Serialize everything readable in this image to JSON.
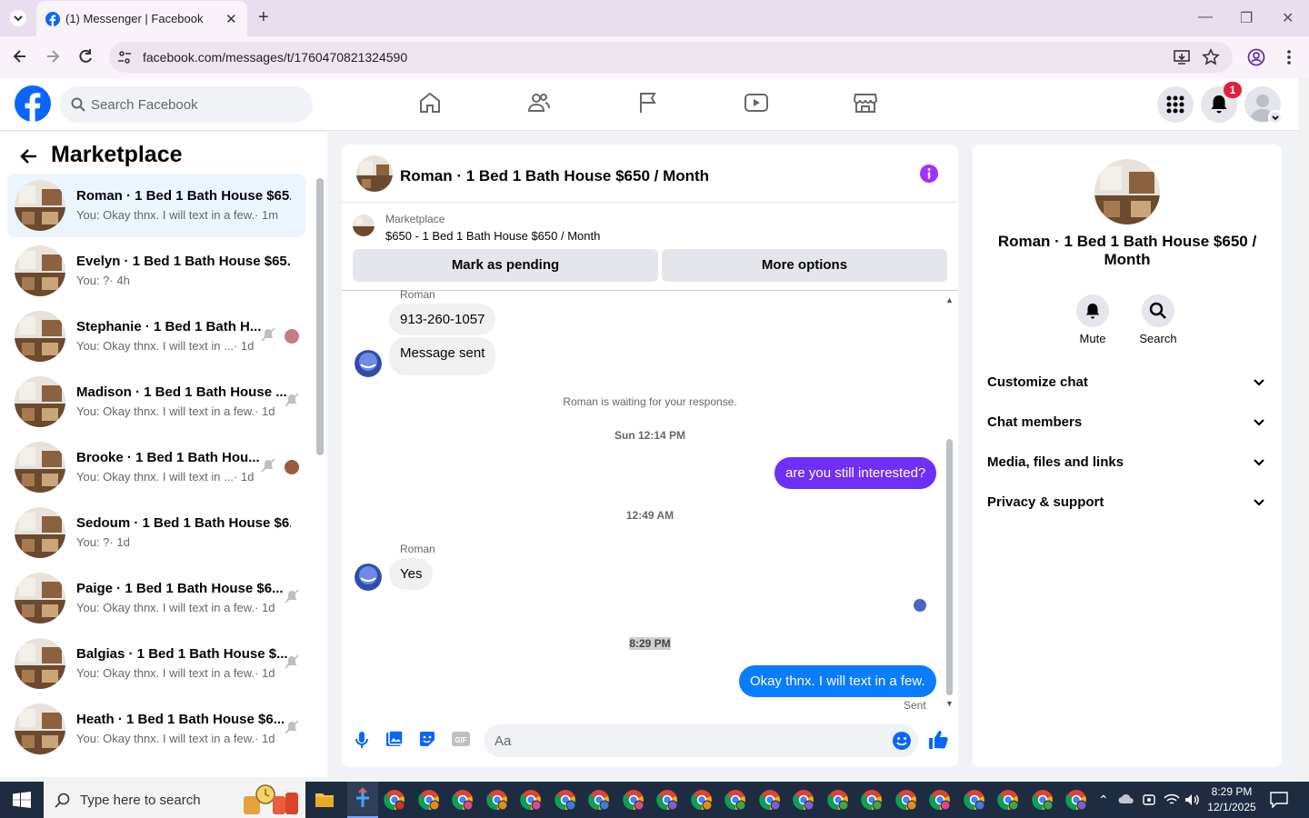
{
  "browser": {
    "tab_title": "(1) Messenger | Facebook",
    "url": "facebook.com/messages/t/1760470821324590"
  },
  "header": {
    "search_placeholder": "Search Facebook",
    "notification_count": "1",
    "brand_color": "#0866ff"
  },
  "sidebar": {
    "title": "Marketplace",
    "conversations": [
      {
        "name": "Roman · 1 Bed 1 Bath House $65...",
        "snippet": "You: Okay thnx. I will text in a few.",
        "time": "· 1m"
      },
      {
        "name": "Evelyn · 1 Bed 1 Bath House $65...",
        "snippet": "You: ?",
        "time": "· 4h"
      },
      {
        "name": "Stephanie · 1 Bed 1 Bath H...",
        "snippet": "You: Okay thnx. I will text in ...",
        "time": "· 1d"
      },
      {
        "name": "Madison · 1 Bed 1 Bath House ...",
        "snippet": "You: Okay thnx. I will text in a few.",
        "time": "· 1d"
      },
      {
        "name": "Brooke · 1 Bed 1 Bath Hou...",
        "snippet": "You: Okay thnx. I will text in ...",
        "time": "· 1d"
      },
      {
        "name": "Sedoum · 1 Bed 1 Bath House $6...",
        "snippet": "You: ?",
        "time": "· 1d"
      },
      {
        "name": "Paige · 1 Bed 1 Bath House $6...",
        "snippet": "You: Okay thnx. I will text in a few.",
        "time": "· 1d"
      },
      {
        "name": "Balgias · 1 Bed 1 Bath House $...",
        "snippet": "You: Okay thnx. I will text in a few.",
        "time": "· 1d"
      },
      {
        "name": "Heath · 1 Bed 1 Bath House $6...",
        "snippet": "You: Okay thnx. I will text in a few.",
        "time": "· 1d"
      }
    ]
  },
  "chat": {
    "title": "Roman · 1 Bed 1 Bath House $650 / Month",
    "marketplace_label": "Marketplace",
    "listing": "$650 - 1 Bed 1 Bath House $650 / Month",
    "mark_pending": "Mark as pending",
    "more_options": "More options",
    "sender_top": "Roman",
    "msg_phone": "913-260-1057",
    "msg_sent": "Message sent",
    "waiting": "Roman is waiting for your response.",
    "stamp1": "Sun 12:14 PM",
    "out_msg1": "are you still interested?",
    "stamp2": "12:49 AM",
    "sender_mid": "Roman",
    "msg_yes": "Yes",
    "stamp3": "8:29 PM",
    "out_msg2": "Okay thnx. I will text in a few.",
    "status": "Sent",
    "composer_placeholder": "Aa"
  },
  "details": {
    "name": "Roman · 1 Bed 1 Bath House $650 / Month",
    "mute": "Mute",
    "search": "Search",
    "sections": [
      "Customize chat",
      "Chat members",
      "Media, files and links",
      "Privacy & support"
    ]
  },
  "taskbar": {
    "search_placeholder": "Type here to search",
    "time": "8:29 PM",
    "date": "12/1/2025"
  }
}
